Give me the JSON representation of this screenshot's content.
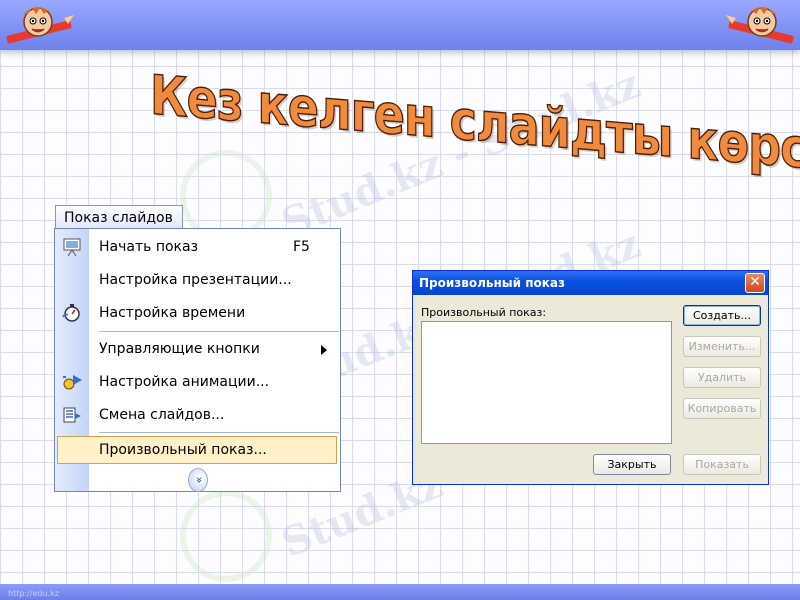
{
  "title": "Кез келген слайдты көрсету",
  "watermark": "Stud.kz - Stud.kz",
  "footer_url": "http://edu.kz",
  "menu": {
    "tab_label": "Показ слайдов",
    "items": [
      {
        "label": "Начать показ",
        "shortcut": "F5",
        "icon": "projector-screen-icon"
      },
      {
        "label": "Настройка презентации...",
        "shortcut": "",
        "icon": ""
      },
      {
        "label": "Настройка времени",
        "shortcut": "",
        "icon": "stopwatch-icon"
      },
      {
        "label": "Управляющие кнопки",
        "shortcut": "",
        "icon": "",
        "submenu": true
      },
      {
        "label": "Настройка анимации...",
        "shortcut": "",
        "icon": "animation-star-icon"
      },
      {
        "label": "Смена слайдов...",
        "shortcut": "",
        "icon": "slide-transition-icon"
      },
      {
        "label": "Произвольный показ...",
        "shortcut": "",
        "icon": "",
        "selected": true
      }
    ],
    "expand_glyph": "»"
  },
  "dialog": {
    "title": "Произвольный показ",
    "close_glyph": "✕",
    "list_label": "Произвольный показ:",
    "buttons": {
      "create": "Создать...",
      "edit": "Изменить...",
      "delete": "Удалить",
      "copy": "Копировать",
      "close": "Закрыть",
      "show": "Показать"
    }
  },
  "colors": {
    "band": "#7e90f5",
    "title_fill": "#f08a3c",
    "titlebar": "#0a52e0",
    "selection": "#fff1c7"
  }
}
